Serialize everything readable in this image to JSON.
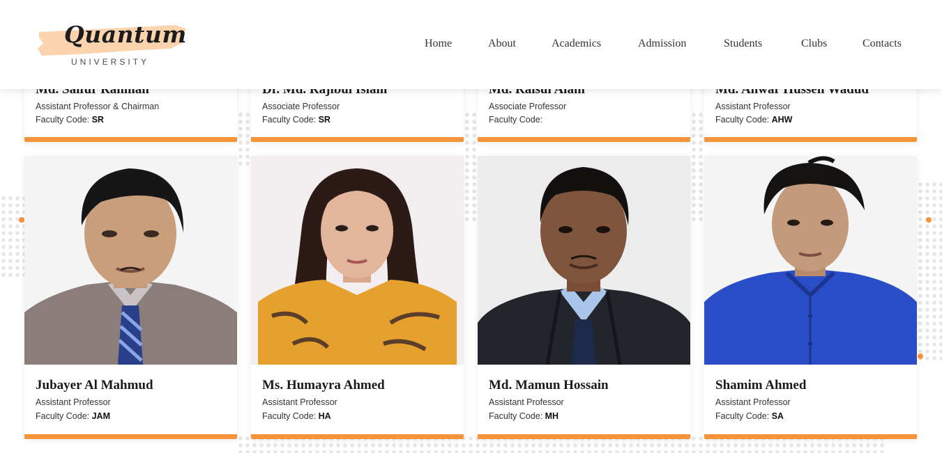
{
  "header": {
    "logo_word": "Quantum",
    "logo_sub": "UNIVERSITY",
    "nav": [
      "Home",
      "About",
      "Academics",
      "Admission",
      "Students",
      "Clubs",
      "Contacts"
    ]
  },
  "faculty_code_label": "Faculty Code: ",
  "colors": {
    "accent": "#f7943a",
    "logo_brush": "#fbd3ad"
  },
  "top_row": [
    {
      "name": "Md. Saifur Rahman",
      "role": "Assistant Professor & Chairman",
      "code": "SR"
    },
    {
      "name": "Dr. Md. Rajibul Islam",
      "role": "Associate Professor",
      "code": "SR"
    },
    {
      "name": "Md. Raisul Alam",
      "role": "Associate Professor",
      "code": ""
    },
    {
      "name": "Md. Anwar Hussen Wadud",
      "role": "Assistant Professor",
      "code": "AHW"
    }
  ],
  "bottom_row": [
    {
      "name": "Jubayer Al Mahmud",
      "role": "Assistant Professor",
      "code": "JAM",
      "photo": "faculty-photo"
    },
    {
      "name": "Ms. Humayra Ahmed",
      "role": "Assistant Professor",
      "code": "HA",
      "photo": "faculty-photo"
    },
    {
      "name": "Md. Mamun Hossain",
      "role": "Assistant Professor",
      "code": "MH",
      "photo": "faculty-photo"
    },
    {
      "name": "Shamim Ahmed",
      "role": "Assistant Professor",
      "code": "SA",
      "photo": "faculty-photo"
    }
  ]
}
